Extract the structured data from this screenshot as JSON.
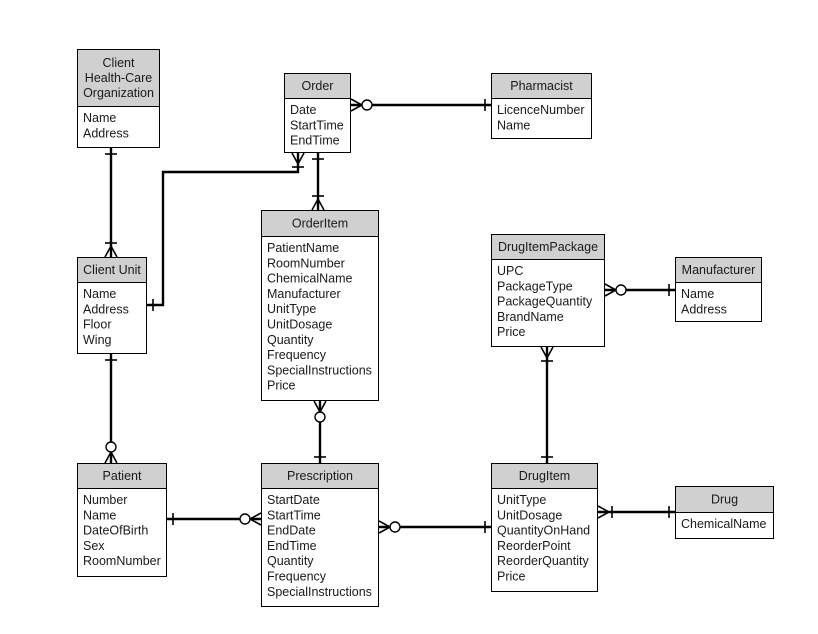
{
  "diagram": {
    "type": "entity-relationship",
    "notation": "crow's foot",
    "entities": [
      {
        "id": "client_hco",
        "title_lines": [
          "Client",
          "Health-Care",
          "Organization"
        ],
        "attributes": [
          "Name",
          "Address"
        ]
      },
      {
        "id": "order",
        "title_lines": [
          "Order"
        ],
        "attributes": [
          "Date",
          "StartTime",
          "EndTime"
        ]
      },
      {
        "id": "pharmacist",
        "title_lines": [
          "Pharmacist"
        ],
        "attributes": [
          "LicenceNumber",
          "Name"
        ]
      },
      {
        "id": "client_unit",
        "title_lines": [
          "Client Unit"
        ],
        "attributes": [
          "Name",
          "Address",
          "Floor",
          "Wing"
        ]
      },
      {
        "id": "order_item",
        "title_lines": [
          "OrderItem"
        ],
        "attributes": [
          "PatientName",
          "RoomNumber",
          "ChemicalName",
          "Manufacturer",
          "UnitType",
          "UnitDosage",
          "Quantity",
          "Frequency",
          "SpecialInstructions",
          "Price"
        ]
      },
      {
        "id": "drug_item_package",
        "title_lines": [
          "DrugItemPackage"
        ],
        "attributes": [
          "UPC",
          "PackageType",
          "PackageQuantity",
          "BrandName",
          "Price"
        ]
      },
      {
        "id": "manufacturer",
        "title_lines": [
          "Manufacturer"
        ],
        "attributes": [
          "Name",
          "Address"
        ]
      },
      {
        "id": "patient",
        "title_lines": [
          "Patient"
        ],
        "attributes": [
          "Number",
          "Name",
          "DateOfBirth",
          "Sex",
          "RoomNumber"
        ]
      },
      {
        "id": "prescription",
        "title_lines": [
          "Prescription"
        ],
        "attributes": [
          "StartDate",
          "StartTime",
          "EndDate",
          "EndTime",
          "Quantity",
          "Frequency",
          "SpecialInstructions"
        ]
      },
      {
        "id": "drug_item",
        "title_lines": [
          "DrugItem"
        ],
        "attributes": [
          "UnitType",
          "UnitDosage",
          "QuantityOnHand",
          "ReorderPoint",
          "ReorderQuantity",
          "Price"
        ]
      },
      {
        "id": "drug",
        "title_lines": [
          "Drug"
        ],
        "attributes": [
          "ChemicalName"
        ]
      }
    ],
    "relationships": [
      {
        "from": "client_hco",
        "from_card": "one-mandatory",
        "to": "client_unit",
        "to_card": "many-mandatory"
      },
      {
        "from": "client_unit",
        "from_card": "one-mandatory",
        "to": "order",
        "to_card": "many-mandatory"
      },
      {
        "from": "order",
        "from_card": "many-optional",
        "to": "pharmacist",
        "to_card": "one-mandatory"
      },
      {
        "from": "order",
        "from_card": "one-mandatory",
        "to": "order_item",
        "to_card": "many-mandatory"
      },
      {
        "from": "client_unit",
        "from_card": "one-mandatory",
        "to": "patient",
        "to_card": "many-optional"
      },
      {
        "from": "order_item",
        "from_card": "many-optional",
        "to": "prescription",
        "to_card": "one-mandatory"
      },
      {
        "from": "patient",
        "from_card": "one-mandatory",
        "to": "prescription",
        "to_card": "many-optional"
      },
      {
        "from": "prescription",
        "from_card": "many-optional",
        "to": "drug_item",
        "to_card": "one-mandatory"
      },
      {
        "from": "drug_item_package",
        "from_card": "many-optional",
        "to": "manufacturer",
        "to_card": "one-mandatory"
      },
      {
        "from": "drug_item_package",
        "from_card": "many-mandatory",
        "to": "drug_item",
        "to_card": "one-mandatory"
      },
      {
        "from": "drug_item",
        "from_card": "many-mandatory",
        "to": "drug",
        "to_card": "one-mandatory"
      }
    ]
  }
}
